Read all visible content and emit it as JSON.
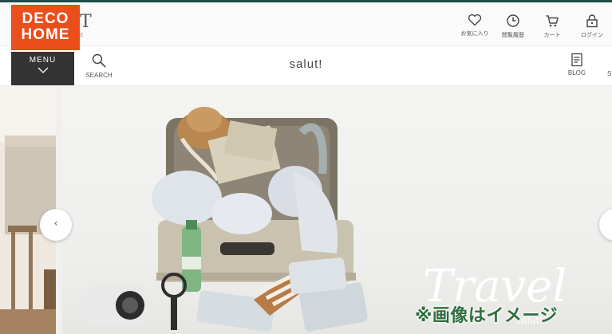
{
  "badge": {
    "line1": "DECO",
    "line2": "HOME"
  },
  "site_logo": {
    "partial_text": "T",
    "subtext": "E"
  },
  "utility_nav": [
    {
      "label": "お気に入り",
      "icon": "heart-icon"
    },
    {
      "label": "閲覧履歴",
      "icon": "clock-icon"
    },
    {
      "label": "カート",
      "icon": "cart-icon"
    },
    {
      "label": "ログイン",
      "icon": "lock-icon"
    }
  ],
  "nav": {
    "menu_label": "MENU",
    "search_label": "SEARCH",
    "shop_title": "salut!",
    "blog_label": "BLOG",
    "cut_label": "S"
  },
  "hero": {
    "script_text": "Travel",
    "sub_text": "salut!",
    "prev_arrow": "‹"
  },
  "image_note": "※画像はイメージ",
  "colors": {
    "accent_line": "#1f4d4a",
    "badge": "#e94e1b",
    "menu_bg": "#333333",
    "note_text": "#2e6f3f"
  }
}
